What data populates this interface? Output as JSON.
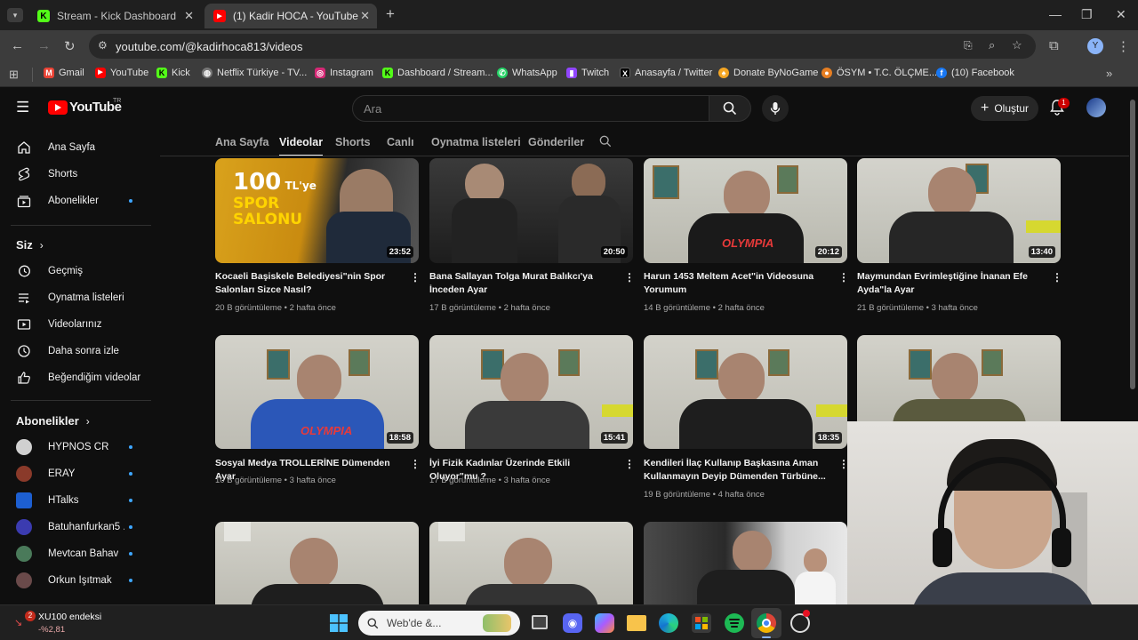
{
  "browser": {
    "tabs": [
      {
        "title": "Stream - Kick Dashboard",
        "favicon": "K",
        "color": "#53fc18",
        "active": false
      },
      {
        "title": "(1) Kadir HOCA - YouTube",
        "favicon": "▶",
        "color": "#ff0000",
        "active": true
      }
    ],
    "new_tab_label": "+",
    "url": "youtube.com/@kadirhoca813/videos",
    "profile_initial": "Y",
    "bookmarks": [
      {
        "label": "Gmail",
        "icon": "gmail-icon",
        "color": "#ea4335"
      },
      {
        "label": "YouTube",
        "icon": "youtube-icon",
        "color": "#ff0000"
      },
      {
        "label": "Kick",
        "icon": "kick-icon",
        "color": "#53fc18"
      },
      {
        "label": "Netflix Türkiye - TV...",
        "icon": "globe-icon",
        "color": "#777777"
      },
      {
        "label": "Instagram",
        "icon": "instagram-icon",
        "color": "#d62976"
      },
      {
        "label": "Dashboard / Stream...",
        "icon": "kick-icon",
        "color": "#53fc18"
      },
      {
        "label": "WhatsApp",
        "icon": "whatsapp-icon",
        "color": "#25d366"
      },
      {
        "label": "Twitch",
        "icon": "twitch-icon",
        "color": "#9146ff"
      },
      {
        "label": "Anasayfa / Twitter",
        "icon": "x-icon",
        "color": "#000000"
      },
      {
        "label": "Donate ByNoGame",
        "icon": "bynogame-icon",
        "color": "#f5a623"
      },
      {
        "label": "ÖSYM • T.C. ÖLÇME...",
        "icon": "osym-icon",
        "color": "#e67e22"
      },
      {
        "label": "(10) Facebook",
        "icon": "facebook-icon",
        "color": "#1877f2"
      }
    ]
  },
  "youtube": {
    "logo_text": "YouTube",
    "logo_region": "TR",
    "search_placeholder": "Ara",
    "create_label": "Oluştur",
    "notification_count": "1",
    "sidebar": {
      "main": [
        {
          "label": "Ana Sayfa",
          "icon": "home-icon"
        },
        {
          "label": "Shorts",
          "icon": "shorts-icon"
        },
        {
          "label": "Abonelikler",
          "icon": "subscriptions-icon"
        }
      ],
      "you_heading": "Siz",
      "you": [
        {
          "label": "Geçmiş",
          "icon": "history-icon"
        },
        {
          "label": "Oynatma listeleri",
          "icon": "playlists-icon"
        },
        {
          "label": "Videolarınız",
          "icon": "your-videos-icon"
        },
        {
          "label": "Daha sonra izle",
          "icon": "watch-later-icon"
        },
        {
          "label": "Beğendiğim videolar",
          "icon": "liked-icon"
        }
      ],
      "subs_heading": "Abonelikler",
      "subs": [
        {
          "label": "HYPNOS CR",
          "color": "#c9c9c9"
        },
        {
          "label": "ERAY",
          "color": "#8a3a2a"
        },
        {
          "label": "HTalks",
          "color": "#1d5fd1"
        },
        {
          "label": "Batuhanfurkan5 ...",
          "color": "#3b3bb0"
        },
        {
          "label": "Mevtcan Bahav",
          "color": "#4a7a5a"
        },
        {
          "label": "Orkun Işıtmak",
          "color": "#6a4a4a"
        }
      ]
    },
    "channel_tabs": [
      "Ana Sayfa",
      "Videolar",
      "Shorts",
      "Canlı",
      "Oynatma listeleri",
      "Gönderiler"
    ],
    "active_tab": "Videolar",
    "videos": [
      {
        "title_line1": "Kocaeli Başiskele Belediyesi\"nin Spor",
        "title_line2": "Salonları Sizce Nasıl?",
        "duration": "23:52",
        "meta": "20 B görüntüleme • 2 hafta önce",
        "thumb_text": "100 TL'ye SPOR SALONU"
      },
      {
        "title_line1": "Bana Sallayan Tolga Murat Balıkcı'ya",
        "title_line2": "İnceden Ayar",
        "duration": "20:50",
        "meta": "17 B görüntüleme • 2 hafta önce"
      },
      {
        "title_line1": "Harun 1453 Meltem Acet\"in Videosuna",
        "title_line2": "Yorumum",
        "duration": "20:12",
        "meta": "14 B görüntüleme • 2 hafta önce"
      },
      {
        "title_line1": "Maymundan Evrimleştiğine İnanan Efe",
        "title_line2": "Ayda\"la Ayar",
        "duration": "13:40",
        "meta": "21 B görüntüleme • 3 hafta önce"
      },
      {
        "title_line1": "Sosyal Medya TROLLERİNE Dümenden Ayar",
        "title_line2": "",
        "duration": "18:58",
        "meta": "10 B görüntüleme • 3 hafta önce"
      },
      {
        "title_line1": "İyi Fizik Kadınlar Üzerinde Etkili Oluyor\"mu ?",
        "title_line2": "",
        "duration": "15:41",
        "meta": "17 B görüntüleme • 3 hafta önce"
      },
      {
        "title_line1": "Kendileri İlaç Kullanıp Başkasına Aman",
        "title_line2": "Kullanmayın Deyip Dümenden Türbüne...",
        "duration": "18:35",
        "meta": "19 B görüntüleme • 4 hafta önce"
      }
    ]
  },
  "taskbar": {
    "widget_badge": "2",
    "widget_title": "XU100 endeksi",
    "widget_value": "-%2,81",
    "search_placeholder": "Web'de &..."
  }
}
